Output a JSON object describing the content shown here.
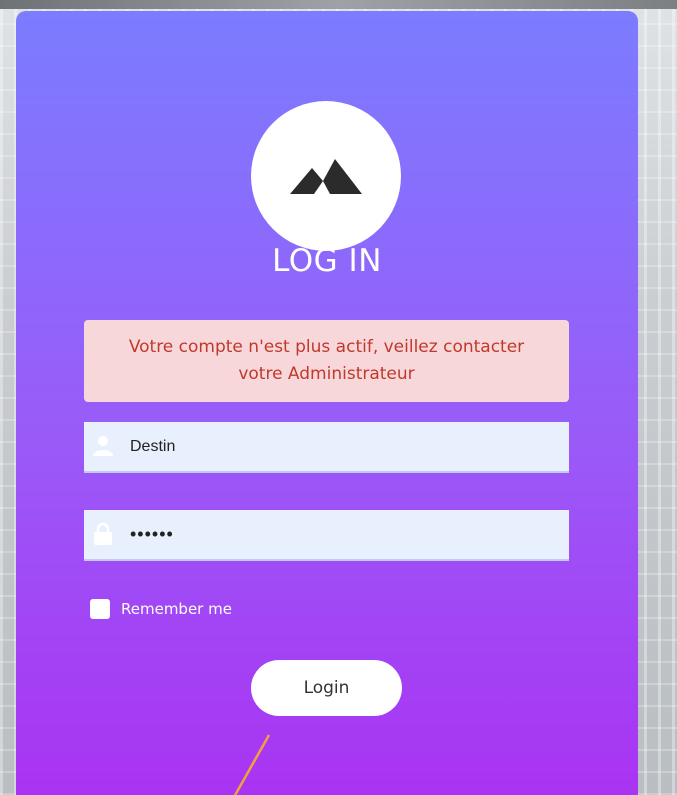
{
  "login": {
    "title": "LOG IN",
    "alert_message": "Votre compte n'est plus actif, veillez contacter votre Administrateur",
    "username_value": "Destin",
    "password_value": "••••••",
    "remember_label": "Remember me",
    "login_button_label": "Login"
  },
  "icons": {
    "logo": "mountain-icon",
    "username": "user-icon",
    "password": "lock-icon"
  },
  "colors": {
    "card_gradient_top": "#7b7cff",
    "card_gradient_bottom": "#a933f2",
    "alert_background": "#f8d7da",
    "alert_text": "#c0392b",
    "input_background": "#e8f0fe"
  }
}
